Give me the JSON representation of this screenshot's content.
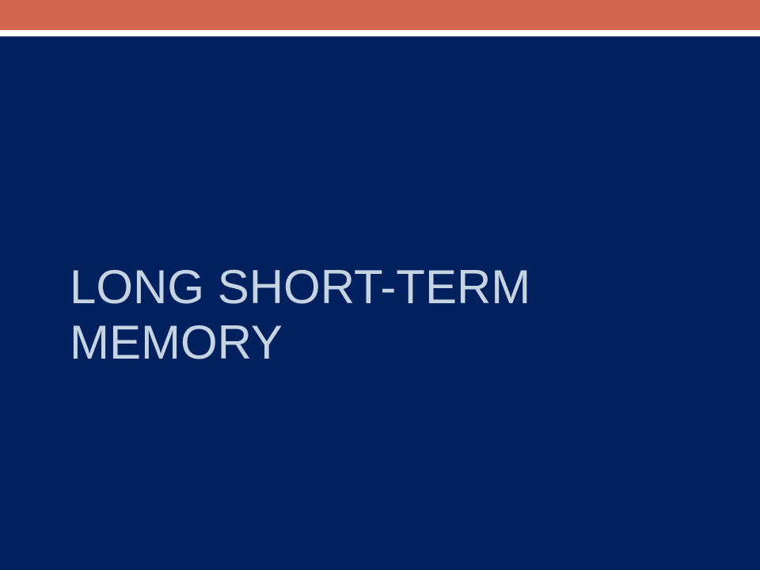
{
  "slide": {
    "title_lines": [
      "LONG SHORT-TERM",
      "MEMORY"
    ]
  },
  "colors": {
    "accent_bar": "#d4654f",
    "divider": "#ffffff",
    "background": "#00215e",
    "title_text": "#c5d3e2"
  }
}
